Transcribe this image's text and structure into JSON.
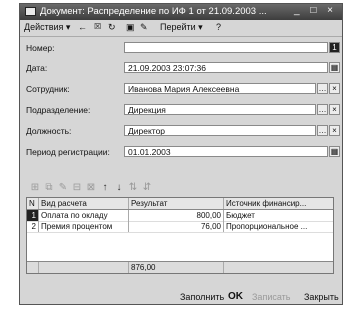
{
  "window": {
    "title": "Документ: Распределение по ИФ 1 от 21.09.2003 ...",
    "title_buttons": "_ □ ×"
  },
  "toolbar": {
    "actions": "Действия ▾",
    "goto": "Перейти ▾",
    "help": "?"
  },
  "form": {
    "number_label": "Номер:",
    "number_value": "1",
    "date_label": "Дата:",
    "date_value": "21.09.2003 23:07:36",
    "employee_label": "Сотрудник:",
    "employee_value": "Иванова Мария Алексеевна",
    "department_label": "Подразделение:",
    "department_value": "Дирекция",
    "position_label": "Должность:",
    "position_value": "Директор",
    "period_label": "Период регистрации:",
    "period_value": "01.01.2003"
  },
  "table": {
    "columns": [
      "N",
      "Вид расчета",
      "Результат",
      "Источник финансир..."
    ],
    "rows": [
      {
        "n": "1",
        "kind": "Оплата по окладу",
        "result": "800,00",
        "source": "Бюджет"
      },
      {
        "n": "2",
        "kind": "Премия процентом",
        "result": "76,00",
        "source": "Пропорциональное ..."
      }
    ],
    "total": "876,00"
  },
  "buttons": {
    "fill": "Заполнить",
    "ok": "OK",
    "record": "Записать",
    "close": "Закрыть"
  }
}
